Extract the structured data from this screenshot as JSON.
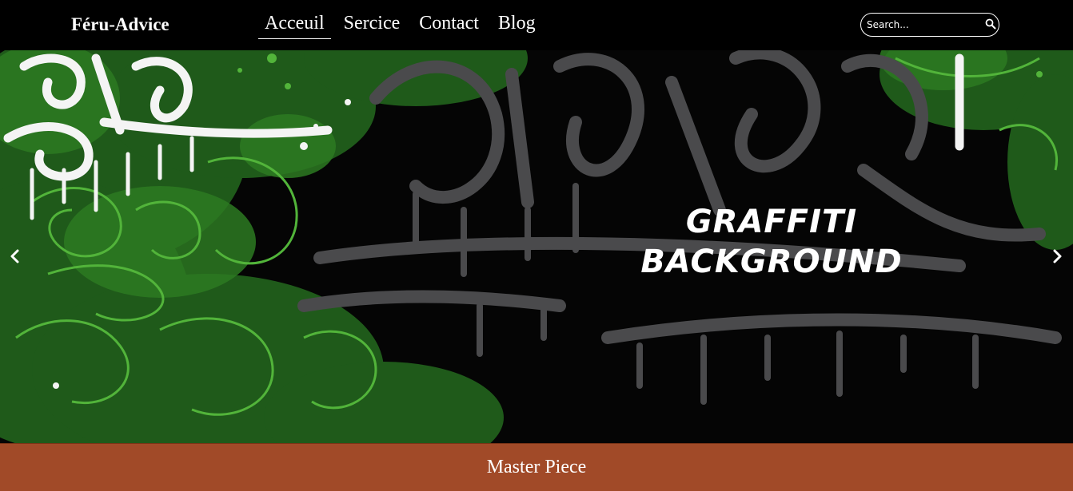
{
  "navbar": {
    "brand": "Féru-Advice",
    "links": [
      {
        "label": "Acceuil",
        "active": true
      },
      {
        "label": "Sercice",
        "active": false
      },
      {
        "label": "Contact",
        "active": false
      },
      {
        "label": "Blog",
        "active": false
      }
    ],
    "search": {
      "placeholder": "Search...",
      "icon": "search-icon"
    }
  },
  "hero": {
    "title_line1": "GRAFFITI",
    "title_line2": "BACKGROUND",
    "prev_icon": "chevron-left-icon",
    "next_icon": "chevron-right-icon",
    "colors": {
      "dark_green": "#1f5a1a",
      "bright_green": "#52b43a",
      "gray_tag": "#4a4a4c",
      "background": "#050505"
    }
  },
  "footer": {
    "label": "Master Piece",
    "color": "#a14a28"
  }
}
